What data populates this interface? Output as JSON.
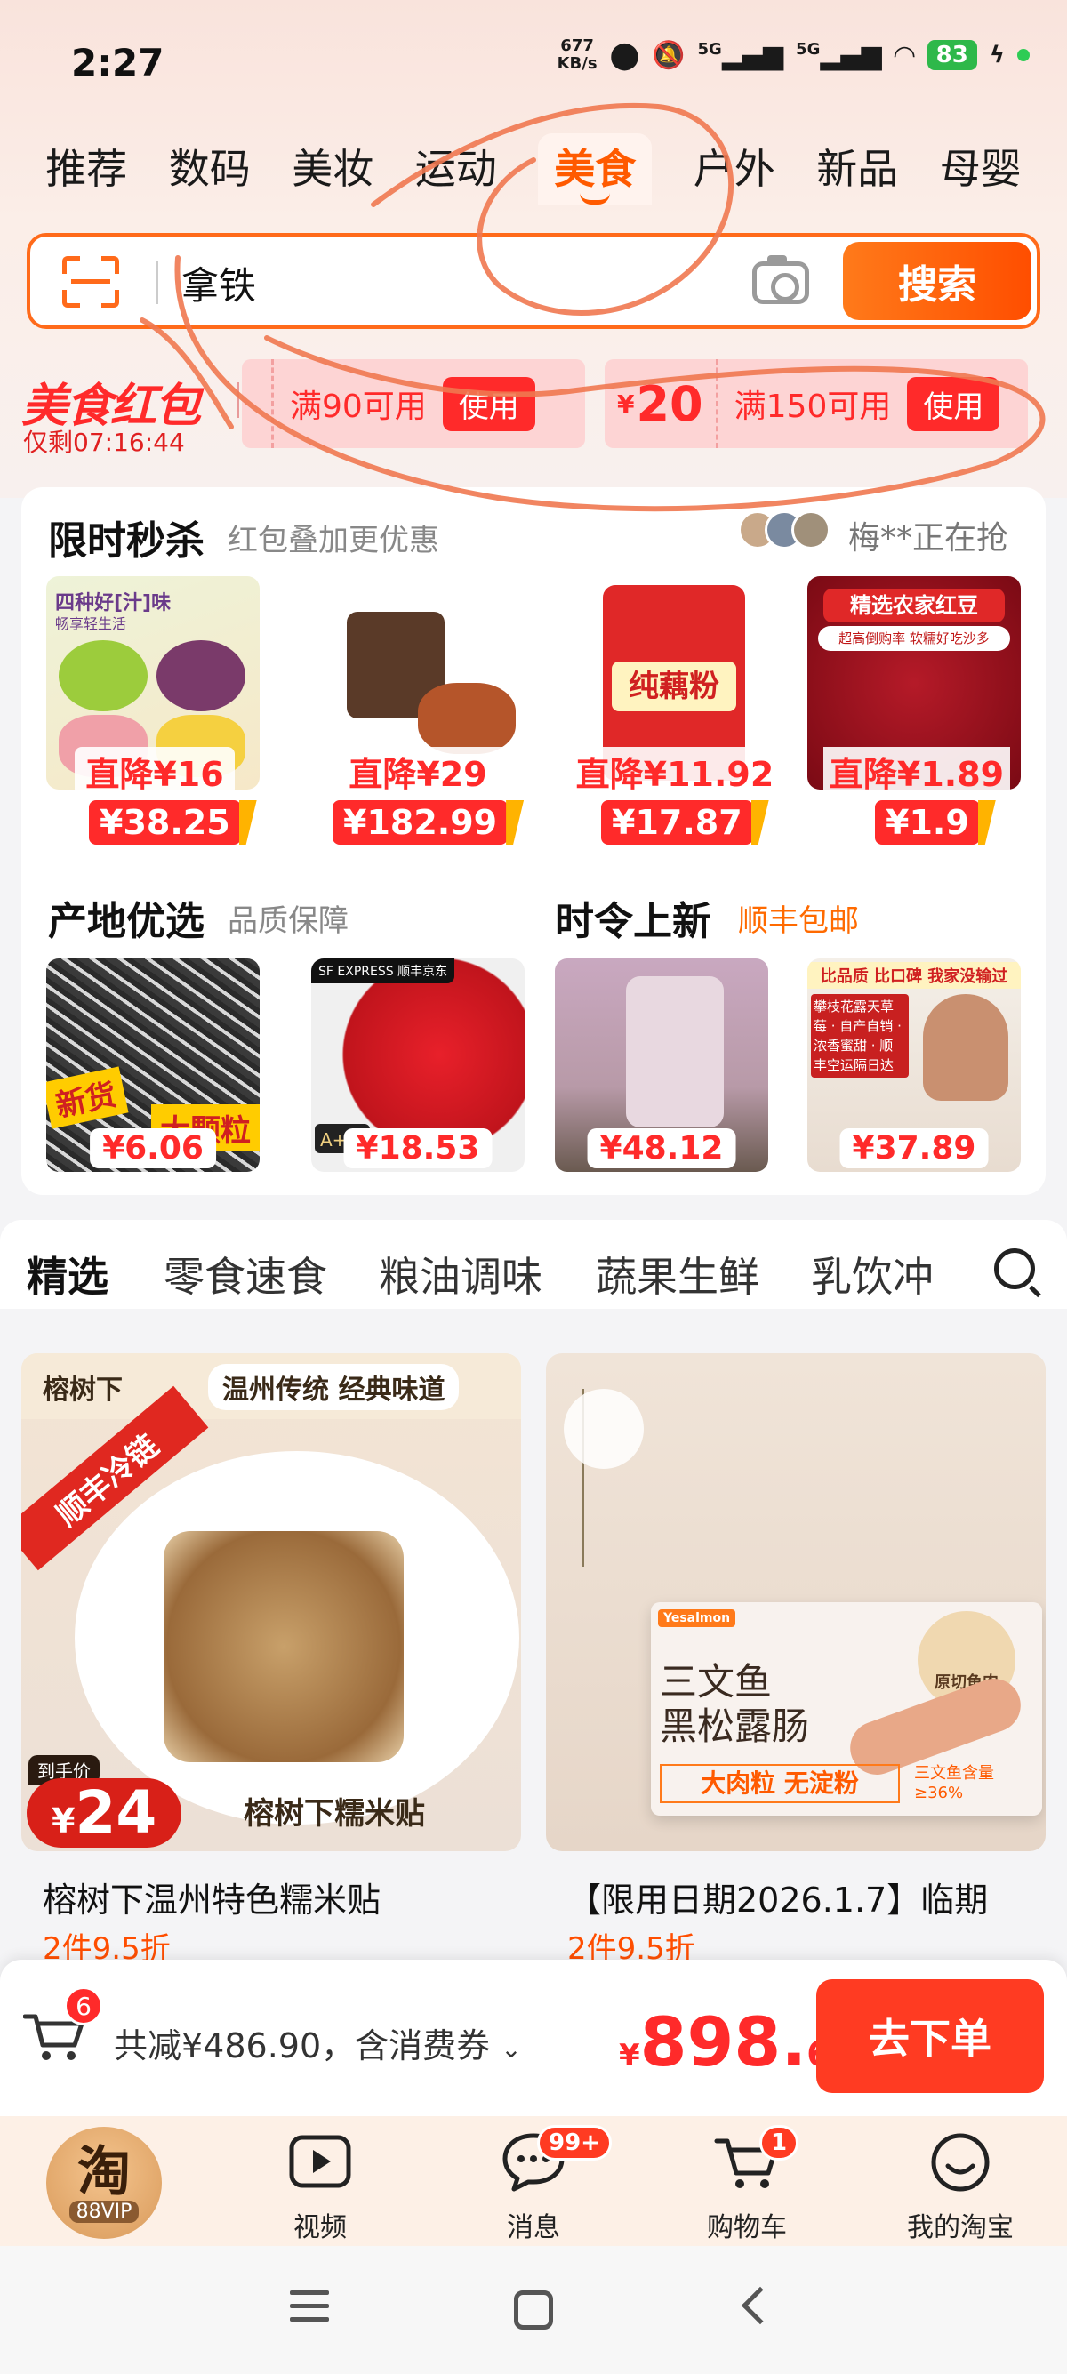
{
  "status": {
    "time": "2:27",
    "net_speed_value": "677",
    "net_speed_unit": "KB/s",
    "network_1": "5G",
    "network_2": "5G",
    "battery": "83"
  },
  "category_tabs": [
    "推荐",
    "数码",
    "美妆",
    "运动",
    "美食",
    "户外",
    "新品",
    "母婴"
  ],
  "active_category": "美食",
  "search": {
    "value": "拿铁",
    "button_label": "搜索"
  },
  "red_packet": {
    "title": "美食红包",
    "timer": "仅剩07:16:44",
    "coupons": [
      {
        "amount": "",
        "condition": "满90可用",
        "action": "使用"
      },
      {
        "amount_currency": "¥",
        "amount": "20",
        "condition": "满150可用",
        "action": "使用"
      }
    ]
  },
  "flash_sale": {
    "title": "限时秒杀",
    "subtitle": "红包叠加更优惠",
    "grabbing_text": "梅**正在抢",
    "products": [
      {
        "drop": "直降¥16",
        "price": "¥38.25",
        "img_label": "四种好[汁]味",
        "img_sub": "畅享轻生活"
      },
      {
        "drop": "直降¥29",
        "price": "¥182.99",
        "img_label": "",
        "img_sub": ""
      },
      {
        "drop": "直降¥11.92",
        "price": "¥17.87",
        "img_label": "纯藕粉",
        "img_sub": ""
      },
      {
        "drop": "直降¥1.89",
        "price": "¥1.9",
        "img_label": "精选农家红豆",
        "img_sub": "超高倒购率 软糯好吃沙多"
      }
    ]
  },
  "origin_select": {
    "title": "产地优选",
    "subtitle": "品质保障",
    "products": [
      {
        "price": "¥6.06",
        "img_label": "新货",
        "img_label2": "大颗粒",
        "img_badge": ""
      },
      {
        "price": "¥18.53",
        "img_label": "A+级",
        "img_label2": "",
        "img_badge": "SF EXPRESS 顺丰京东"
      }
    ]
  },
  "seasonal": {
    "title": "时令上新",
    "subtitle": "顺丰包邮",
    "products": [
      {
        "price": "¥48.12",
        "img_label": "",
        "img_label2": ""
      },
      {
        "price": "¥37.89",
        "img_label": "比品质 比口碑 我家没输过",
        "img_label2": "攀枝花露天草莓 · 自产自销 · 浓香蜜甜 · 顺丰空运隔日达"
      }
    ]
  },
  "feed_tabs": [
    "精选",
    "零食速食",
    "粮油调味",
    "蔬果生鲜",
    "乳饮冲"
  ],
  "feed_active": "精选",
  "feed_items": [
    {
      "brand": "榕树下",
      "tagline": "温州传统 经典味道",
      "ribbon": "顺丰冷链",
      "price_label": "到手价",
      "price_currency": "¥",
      "price": "24",
      "img_caption": "榕树下糯米贴",
      "title": "榕树下温州特色糯米贴",
      "discount": "2件9.5折"
    },
    {
      "brand": "Yesalmon",
      "product_line1": "三文鱼",
      "product_line2": "黑松露肠",
      "badge": "原切鱼肉",
      "banner": "大肉粒 无淀粉",
      "side_note": "三文鱼含量≥36%",
      "title": "【限用日期2026.1.7】临期",
      "discount": "2件9.5折"
    }
  ],
  "checkout": {
    "cart_count": "6",
    "saving_text": "共减¥486.90，含消费券",
    "total_currency": "¥",
    "total_int": "898.",
    "total_dec": "6",
    "button": "去下单"
  },
  "tabbar": {
    "vip_icon": "淘",
    "vip_label": "88VIP",
    "items": [
      {
        "label": "视频",
        "icon": "video-icon",
        "badge": ""
      },
      {
        "label": "消息",
        "icon": "message-icon",
        "badge": "99+"
      },
      {
        "label": "购物车",
        "icon": "cart-icon",
        "badge": "1"
      },
      {
        "label": "我的淘宝",
        "icon": "profile-icon",
        "badge": ""
      }
    ]
  },
  "colors": {
    "accent": "#ff5a00",
    "price_red": "#ff2a2a",
    "annotation": "#f07850"
  }
}
